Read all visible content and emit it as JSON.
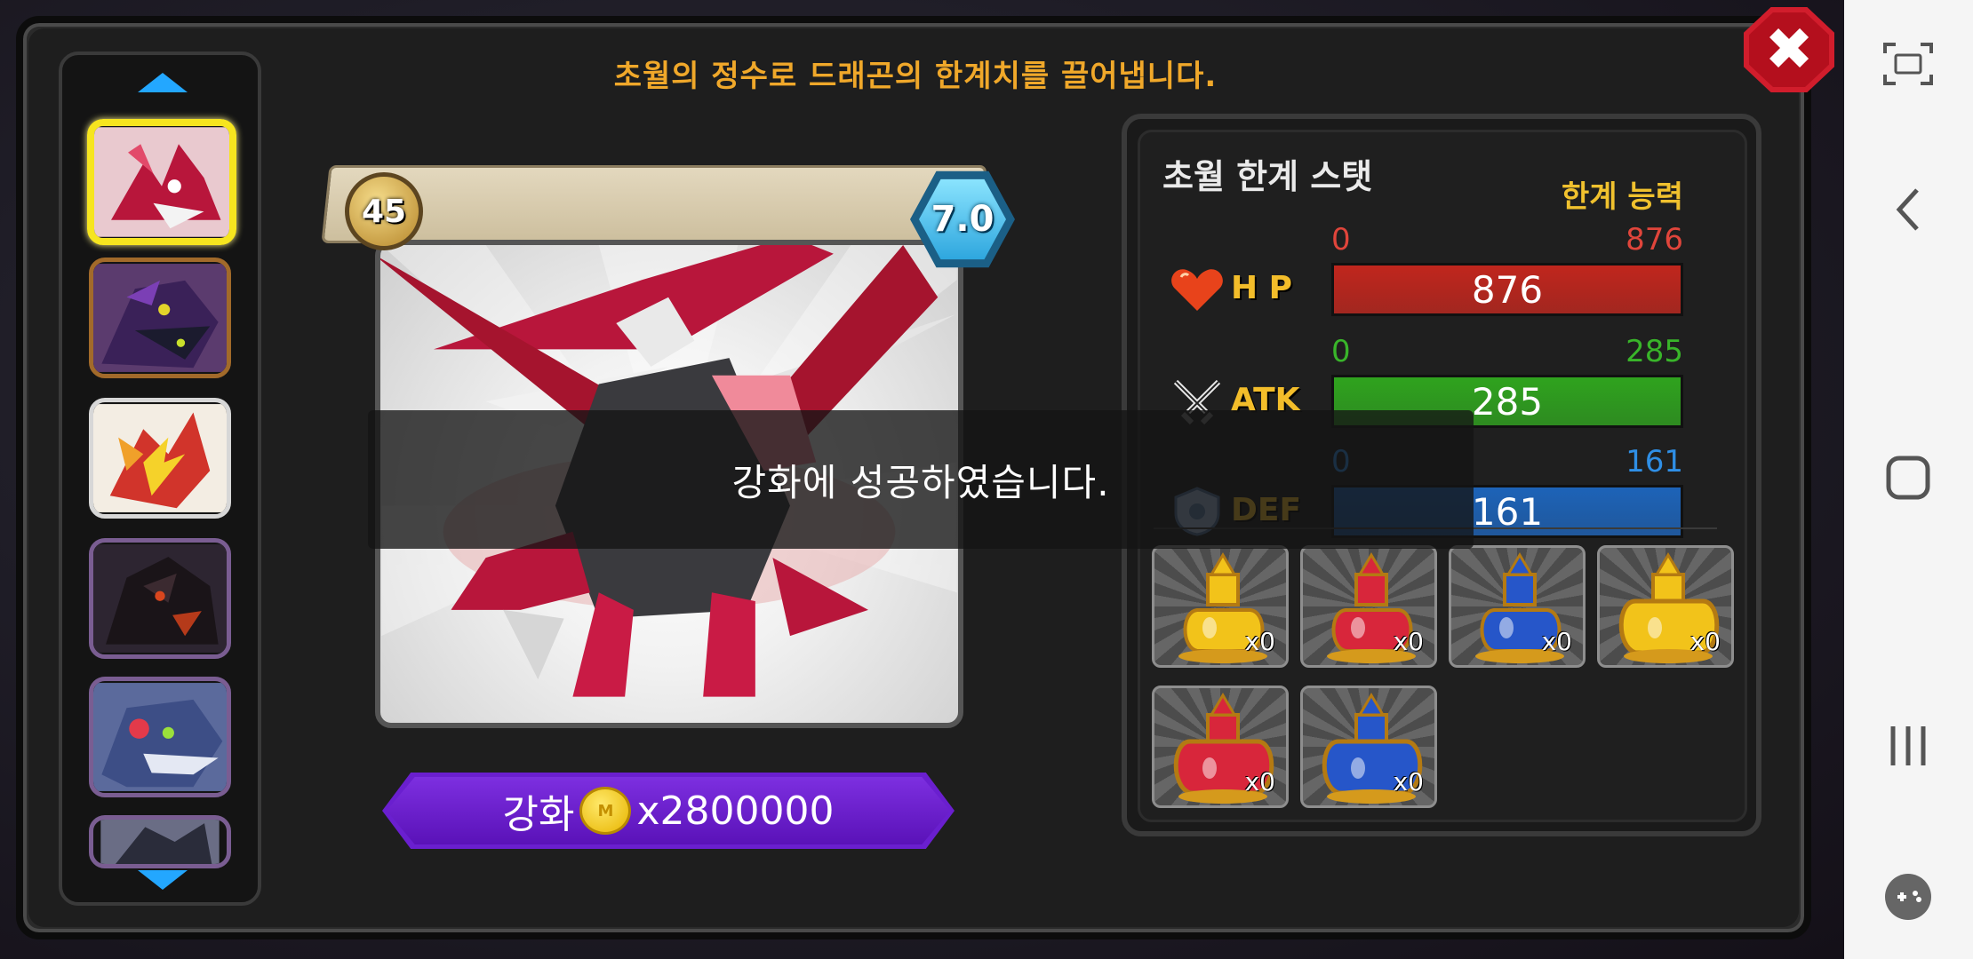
{
  "header": {
    "subtitle": "초월의 정수로 드래곤의 한계치를 끌어냅니다.",
    "close_icon": "close-icon"
  },
  "dragon_list": {
    "items": [
      {
        "name": "dragon-thumb-pink",
        "selected": true
      },
      {
        "name": "dragon-thumb-purple",
        "selected": false
      },
      {
        "name": "dragon-thumb-lightning",
        "selected": false
      },
      {
        "name": "dragon-thumb-dark",
        "selected": false
      },
      {
        "name": "dragon-thumb-blue-red-eye",
        "selected": false
      },
      {
        "name": "dragon-thumb-partial",
        "selected": false
      }
    ]
  },
  "dragon_card": {
    "level": "45",
    "grade": "7.0"
  },
  "upgrade": {
    "label": "강화",
    "coin_mark": "M",
    "cost": "x2800000"
  },
  "stats": {
    "title": "초월 한계 스탯",
    "limit_label": "한계 능력",
    "rows": [
      {
        "key": "hp",
        "label": "H P",
        "min": "0",
        "max": "876",
        "value": "876",
        "fill": 1.0,
        "color": "#c0261d",
        "text_color": "#e0453b"
      },
      {
        "key": "atk",
        "label": "ATK",
        "min": "0",
        "max": "285",
        "value": "285",
        "fill": 1.0,
        "color": "#2fa31e",
        "text_color": "#39b52a"
      },
      {
        "key": "def",
        "label": "DEF",
        "min": "0",
        "max": "161",
        "value": "161",
        "fill": 1.0,
        "color": "#1d63b8",
        "text_color": "#2f8fe6"
      }
    ]
  },
  "potions": [
    {
      "name": "potion-small-yellow",
      "qty": "x0",
      "color": "#f2c31a"
    },
    {
      "name": "potion-small-red",
      "qty": "x0",
      "color": "#d8263b"
    },
    {
      "name": "potion-small-blue",
      "qty": "x0",
      "color": "#2656c9"
    },
    {
      "name": "potion-large-yellow",
      "qty": "x0",
      "color": "#f2c31a"
    },
    {
      "name": "potion-large-red",
      "qty": "x0",
      "color": "#d8263b"
    },
    {
      "name": "potion-large-blue",
      "qty": "x0",
      "color": "#2656c9"
    }
  ],
  "toast": {
    "message": "강화에 성공하였습니다."
  },
  "system_nav": {
    "screenshot_icon": "screenshot-icon",
    "back_icon": "back-icon",
    "home_icon": "home-icon",
    "recents_icon": "recents-icon",
    "game_tools_icon": "game-tools-icon"
  }
}
